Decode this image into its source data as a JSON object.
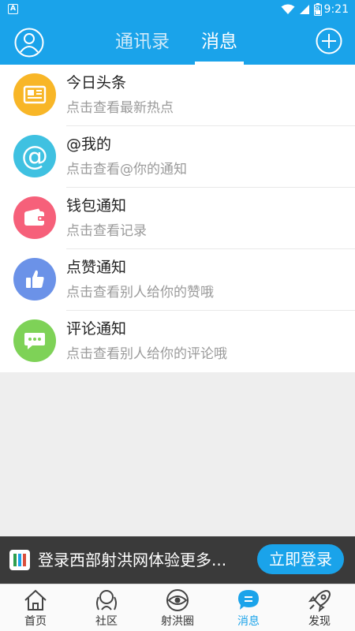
{
  "status_bar": {
    "time": "9:21",
    "app_badge": "A",
    "battery_level": "8"
  },
  "header": {
    "tabs": [
      {
        "label": "通讯录"
      },
      {
        "label": "消息"
      }
    ],
    "active_tab": "消息"
  },
  "messages": [
    {
      "title": "今日头条",
      "subtitle": "点击查看最新热点",
      "icon": "newspaper-icon",
      "color": "#f8b627"
    },
    {
      "title": "@我的",
      "subtitle": "点击查看@你的通知",
      "icon": "at-icon",
      "color": "#3fc1e1"
    },
    {
      "title": "钱包通知",
      "subtitle": "点击查看记录",
      "icon": "wallet-icon",
      "color": "#f6607a"
    },
    {
      "title": "点赞通知",
      "subtitle": "点击查看别人给你的赞哦",
      "icon": "thumbs-up-icon",
      "color": "#6b92e8"
    },
    {
      "title": "评论通知",
      "subtitle": "点击查看别人给你的评论哦",
      "icon": "comment-icon",
      "color": "#7ed257"
    }
  ],
  "promo": {
    "text": "登录西部射洪网体验更多...",
    "button": "立即登录"
  },
  "bottom_nav": {
    "items": [
      {
        "label": "首页",
        "icon": "home-icon"
      },
      {
        "label": "社区",
        "icon": "community-icon"
      },
      {
        "label": "射洪圈",
        "icon": "circle-eye-icon"
      },
      {
        "label": "消息",
        "icon": "message-icon"
      },
      {
        "label": "发现",
        "icon": "rocket-icon"
      }
    ],
    "active": "消息"
  },
  "colors": {
    "accent": "#1aa3ea",
    "promo_bg": "#3a3a3a",
    "background": "#eeeeee"
  }
}
